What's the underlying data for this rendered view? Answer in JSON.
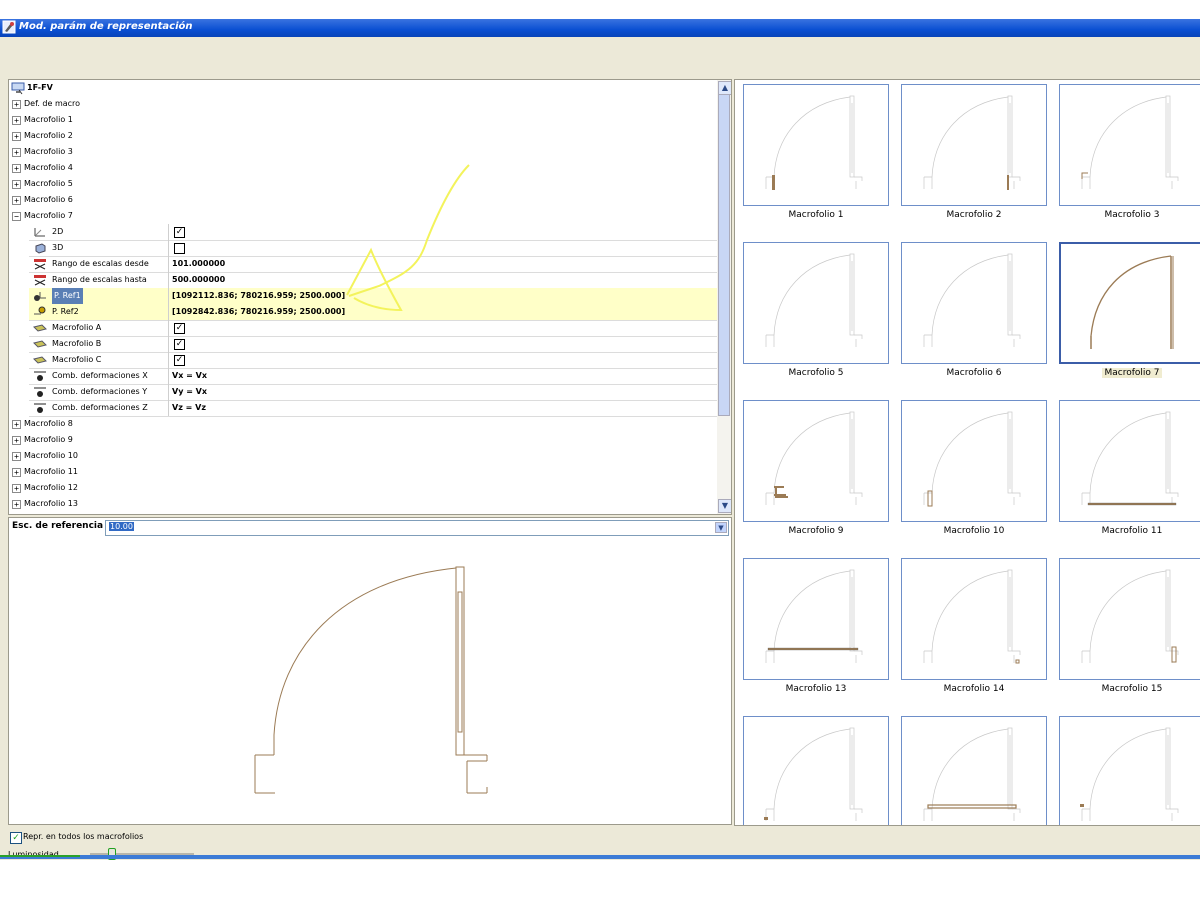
{
  "window": {
    "title": "Mod. parám de representación"
  },
  "tree": {
    "root_label": "1F-FV",
    "top_items": [
      "Def. de macro",
      "Macrofolio 1",
      "Macrofolio 2",
      "Macrofolio 3",
      "Macrofolio 4",
      "Macrofolio 5",
      "Macrofolio 6"
    ],
    "expanded_item": "Macrofolio 7",
    "properties": [
      {
        "label": "2D",
        "value": "",
        "checked": true
      },
      {
        "label": "3D",
        "value": "",
        "checked": false
      },
      {
        "label": "Rango de escalas desde",
        "value": "101.000000"
      },
      {
        "label": "Rango de escalas hasta",
        "value": "500.000000"
      },
      {
        "label": "P. Ref1",
        "value": "[1092112.836; 780216.959; 2500.000]"
      },
      {
        "label": "P. Ref2",
        "value": "[1092842.836; 780216.959; 2500.000]"
      },
      {
        "label": "Macrofolio A",
        "value": "",
        "checked": true
      },
      {
        "label": "Macrofolio B",
        "value": "",
        "checked": true
      },
      {
        "label": "Macrofolio C",
        "value": "",
        "checked": true
      },
      {
        "label": "Comb. deformaciones X",
        "value": "Vx = Vx"
      },
      {
        "label": "Comb. deformaciones Y",
        "value": "Vy = Vx"
      },
      {
        "label": "Comb. deformaciones Z",
        "value": "Vz = Vz"
      }
    ],
    "bottom_items": [
      "Macrofolio 8",
      "Macrofolio 9",
      "Macrofolio 10",
      "Macrofolio 11",
      "Macrofolio 12",
      "Macrofolio 13"
    ]
  },
  "reference": {
    "label": "Esc. de referencia",
    "value": "10.00"
  },
  "gallery": {
    "items": [
      "Macrofolio 1",
      "Macrofolio 2",
      "Macrofolio 3",
      "Macrofolio 5",
      "Macrofolio 6",
      "Macrofolio 7",
      "Macrofolio 9",
      "Macrofolio 10",
      "Macrofolio 11",
      "Macrofolio 13",
      "Macrofolio 14",
      "Macrofolio 15",
      "",
      "",
      ""
    ],
    "selected": "Macrofolio 7"
  },
  "options": {
    "repr_all_label": "Repr. en todos los macrofolios",
    "repr_all_checked": true,
    "luminosity_label": "Luminosidad",
    "luminosity_level": 0.2
  },
  "colors": {
    "drawing": "#9b7b55",
    "title_bar": "#0a4fd2",
    "annotation": "#f3f35c"
  }
}
